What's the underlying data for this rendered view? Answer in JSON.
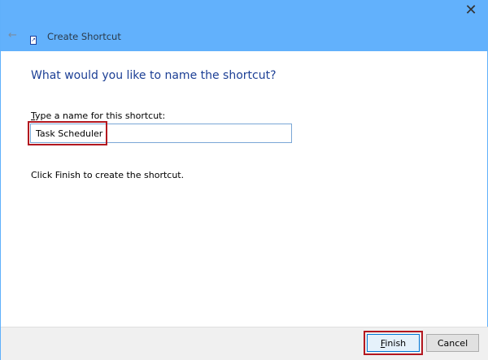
{
  "header": {
    "title": "Create Shortcut",
    "back_icon": "arrow-left-icon",
    "close_icon": "close-icon"
  },
  "main": {
    "question": "What would you like to name the shortcut?",
    "name_label_accel": "T",
    "name_label_rest": "ype a name for this shortcut:",
    "name_value": "Task Scheduler",
    "info": "Click Finish to create the shortcut."
  },
  "footer": {
    "finish_accel": "F",
    "finish_rest": "inish",
    "cancel": "Cancel"
  },
  "colors": {
    "header": "#62b1fc",
    "highlight": "#b3171f",
    "heading": "#1c3f95"
  }
}
